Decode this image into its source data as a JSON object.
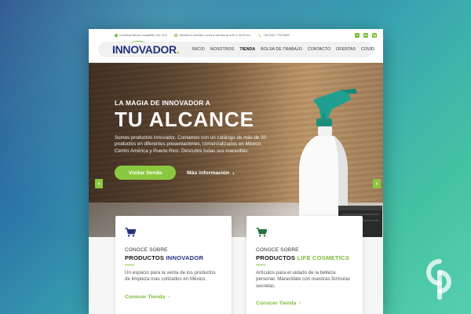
{
  "topbar": {
    "address": "Carretera México-Cuautitlán, Km 14.5",
    "hours": "Atención a clientes: Lunes a Viernes de 8:30 a 18:00 hrs.",
    "phone": "+55 2341 7739 5599",
    "social": [
      "f",
      "in",
      "ig"
    ]
  },
  "nav": {
    "logo": "INNOVADOR",
    "logo_dot": ".",
    "items": [
      {
        "label": "Inicio"
      },
      {
        "label": "Nosotros"
      },
      {
        "label": "Tienda"
      },
      {
        "label": "Bolsa de trabajo"
      },
      {
        "label": "Contacto"
      },
      {
        "label": "Ofertas"
      },
      {
        "label": "Covid"
      }
    ]
  },
  "hero": {
    "eyebrow": "LA MAGIA DE INNOVADOR A",
    "headline": "TU ALCANCE",
    "description": "Somos productos innovador. Contamos con un catálogo de más de 20 productos en diferentes presentaciones, comercializados en México, Centro América y Puerto Rico. Descubre todas sus maravillas.",
    "primary_cta": "Visitar tienda",
    "secondary_cta": "Más información",
    "arrow_left": "‹",
    "arrow_right": "›"
  },
  "cards": [
    {
      "kicker": "CONOCE SOBRE",
      "title_prefix": "PRODUCTOS",
      "title_brand": "INNOVADOR",
      "description": "Un espacio para la venta de los productos de limpieza más cotizados en México.",
      "link": "Conocer Tienda",
      "icon": "cart-icon",
      "icon_color": "#21327e"
    },
    {
      "kicker": "CONOCE SOBRE",
      "title_prefix": "PRODUCTOS",
      "title_brand": "LIFE COSMETICS",
      "description": "Artículos para el uidado de la belleza personal. Maravíllate con nuestras fórmulas secretas.",
      "link": "Conocer Tienda",
      "icon": "cart-icon",
      "icon_color": "#2b6e3f"
    }
  ],
  "colors": {
    "brand_blue": "#21327e",
    "brand_green": "#8cc83f"
  }
}
